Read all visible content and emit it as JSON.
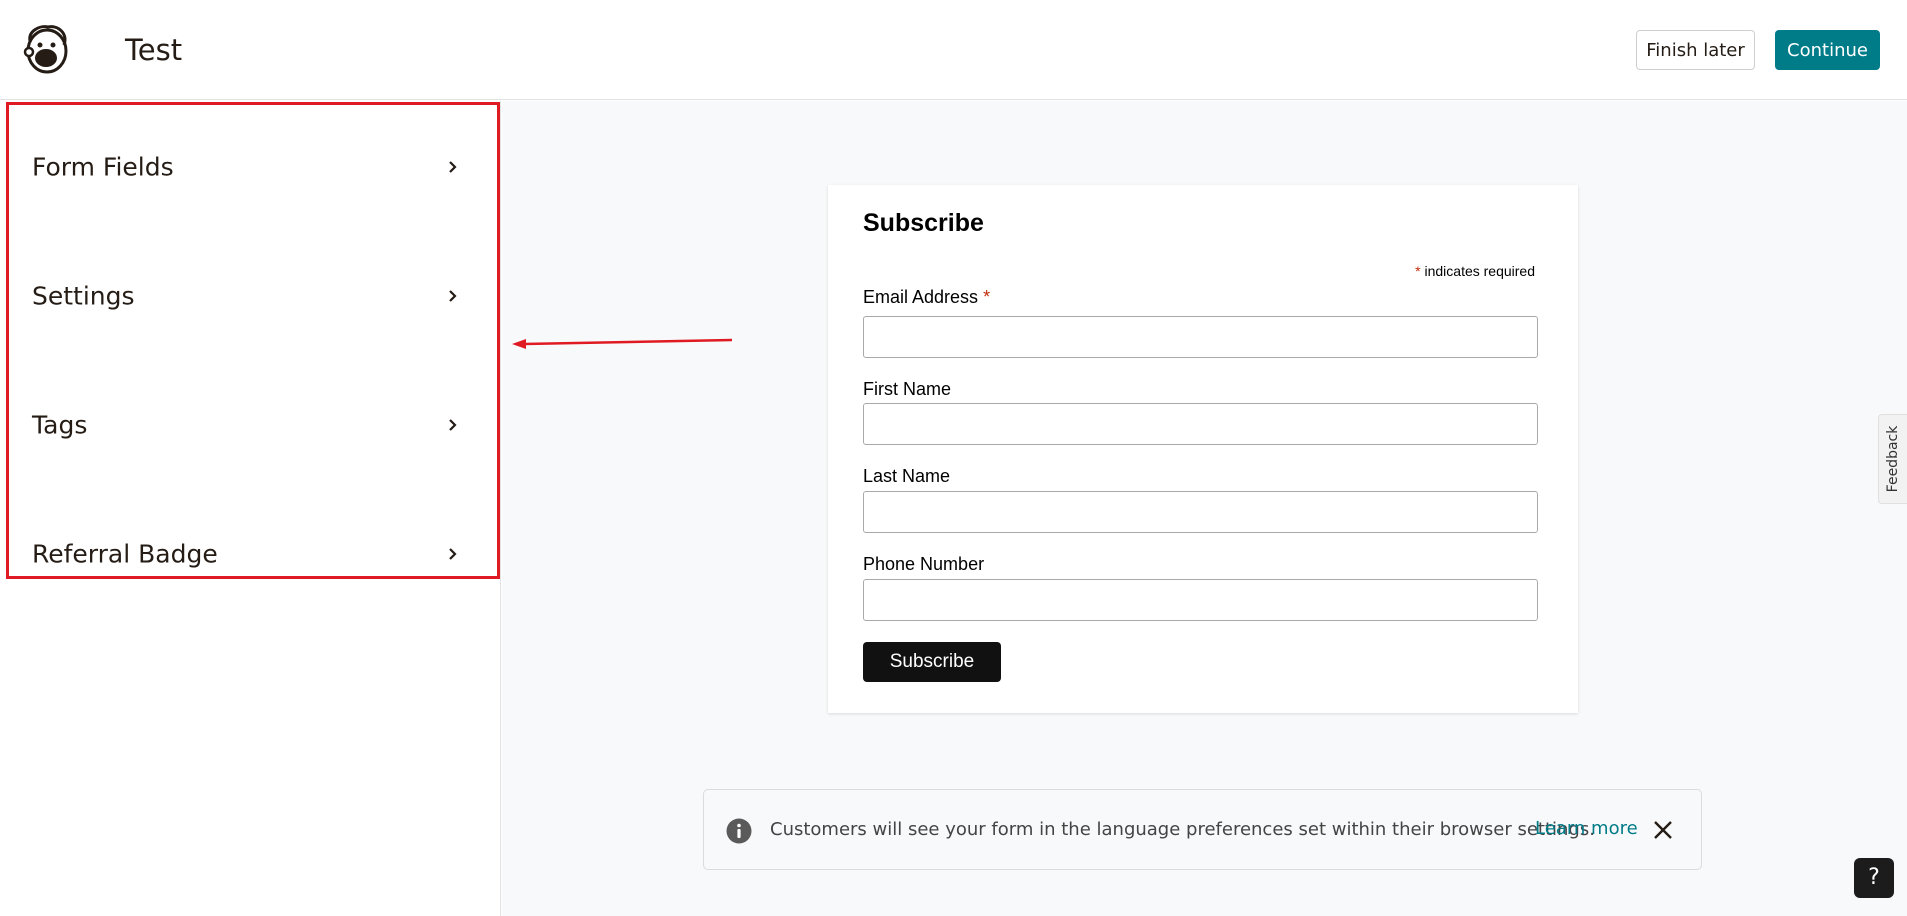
{
  "header": {
    "title": "Test",
    "finish_later_label": "Finish later",
    "continue_label": "Continue",
    "accent_color": "#007c89"
  },
  "sidebar": {
    "items": [
      {
        "label": "Form Fields",
        "icon": "chevron-right-icon"
      },
      {
        "label": "Settings",
        "icon": "chevron-right-icon"
      },
      {
        "label": "Tags",
        "icon": "chevron-right-icon"
      },
      {
        "label": "Referral Badge",
        "icon": "chevron-right-icon"
      }
    ],
    "highlight_color": "#e01a22"
  },
  "form": {
    "title": "Subscribe",
    "required_star": "*",
    "required_note": "indicates required",
    "fields": [
      {
        "label": "Email Address",
        "required": true,
        "value": ""
      },
      {
        "label": "First Name",
        "required": false,
        "value": ""
      },
      {
        "label": "Last Name",
        "required": false,
        "value": ""
      },
      {
        "label": "Phone Number",
        "required": false,
        "value": ""
      }
    ],
    "submit_label": "Subscribe"
  },
  "banner": {
    "message": "Customers will see your form in the language preferences set within their browser settings.",
    "link_label": "Learn more",
    "icon": "info-icon"
  },
  "feedback_label": "Feedback",
  "help_label": "?"
}
